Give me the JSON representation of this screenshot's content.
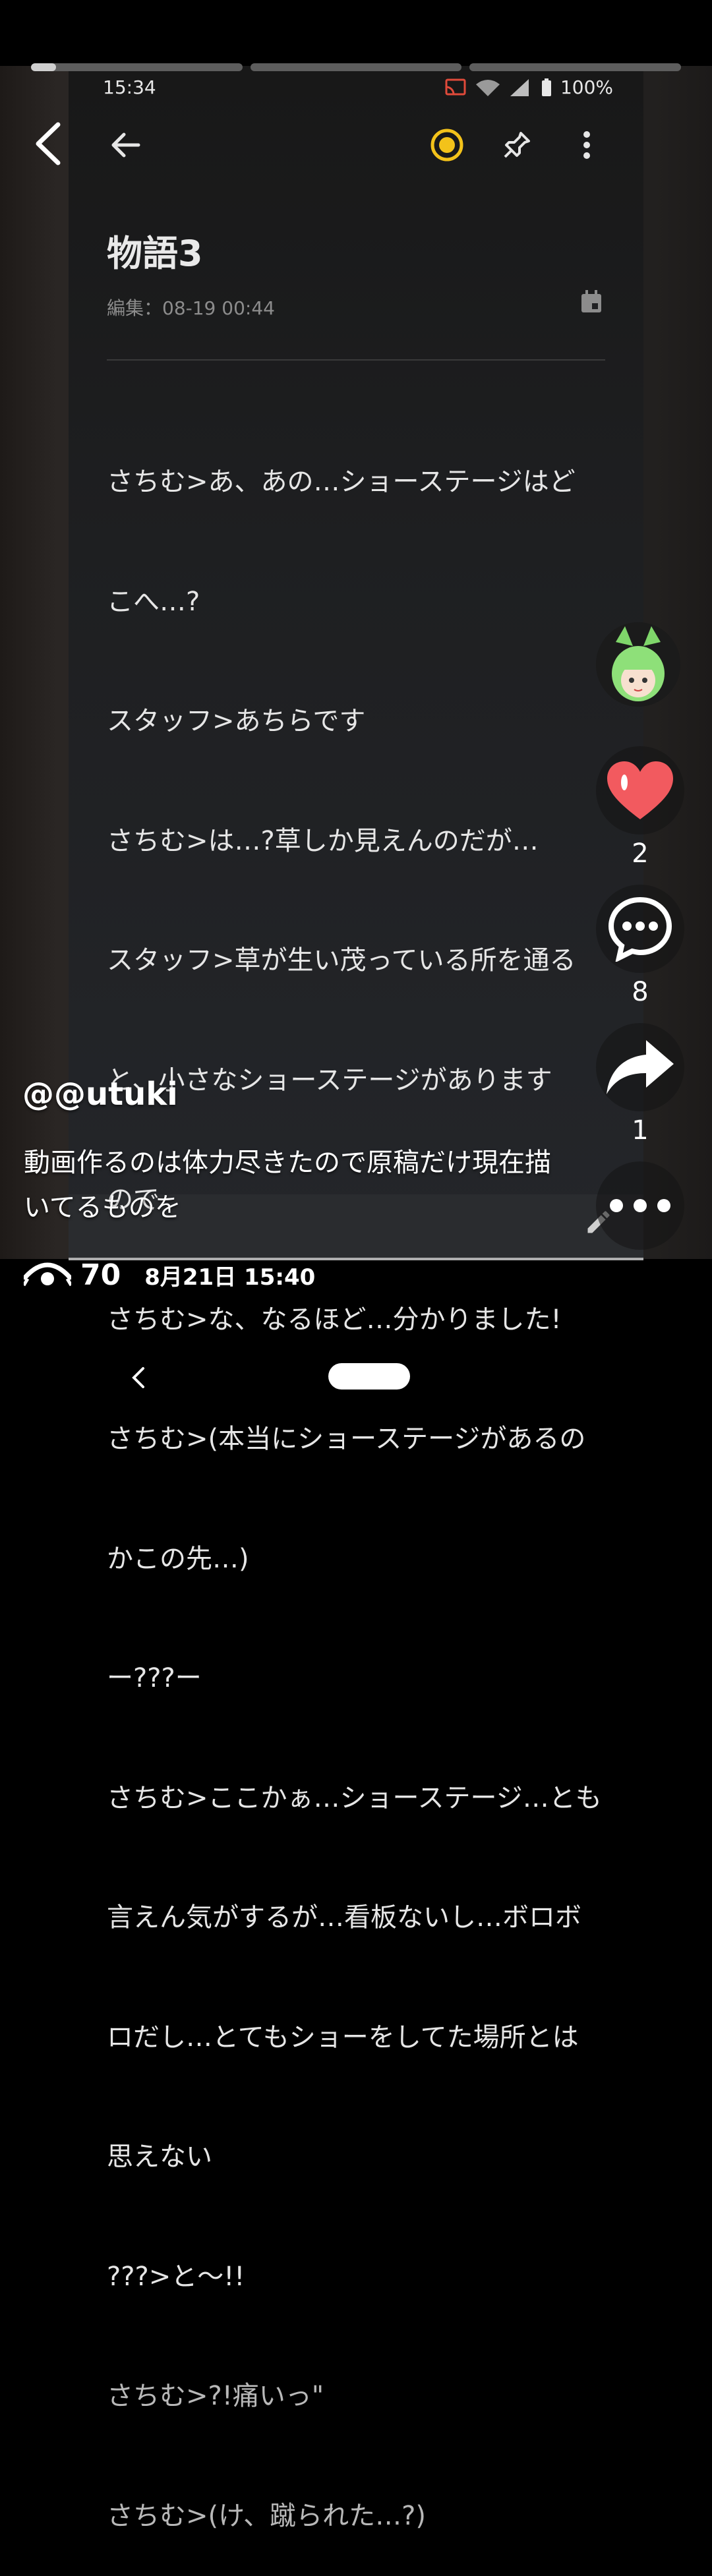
{
  "progress": {
    "segments": [
      0.12,
      0,
      0
    ]
  },
  "status_bar": {
    "time": "15:34",
    "battery": "100%"
  },
  "note": {
    "title": "物語3",
    "meta": "編集：08-19 00:44",
    "lines": [
      "さちむ>あ、あの…ショーステージはど",
      "こへ…?",
      "スタッフ>あちらです",
      "さちむ>は…?草しか見えんのだが…",
      "スタッフ>草が生い茂っている所を通る",
      "と、小さなショーステージがあります",
      "ので",
      "さちむ>な、なるほど…分かりました!",
      "さちむ>(本当にショーステージがあるの",
      "かこの先…)",
      "ー???ー",
      "さちむ>ここかぁ…ショーステージ…とも",
      "言えん気がするが…看板ないし…ボロボ",
      "ロだし…とてもショーをしてた場所とは",
      "思えない",
      "???>と〜!!",
      "さちむ>?!痛いっ\"",
      "さちむ>(け、蹴られた…?)"
    ]
  },
  "rail": {
    "likes": "2",
    "comments": "8",
    "shares": "1"
  },
  "post": {
    "username": "@@utuki",
    "caption": "動画作るのは体力尽きたので原稿だけ現在描いてるものを",
    "views": "70",
    "date": "8月21日 15:40"
  },
  "icons": {
    "back": "back-chevron-icon",
    "arrow_back": "arrow-left-icon",
    "reminder": "reminder-circle-icon",
    "pin": "pin-icon",
    "more": "more-vertical-icon",
    "calendar": "calendar-icon",
    "heart": "heart-icon",
    "comment": "comment-bubble-icon",
    "share": "share-arrow-icon",
    "menu": "more-horizontal-icon",
    "eye": "eye-icon",
    "edit": "pencil-icon"
  },
  "colors": {
    "accent_yellow": "#f3c21a",
    "heart_red": "#f25a5f"
  }
}
